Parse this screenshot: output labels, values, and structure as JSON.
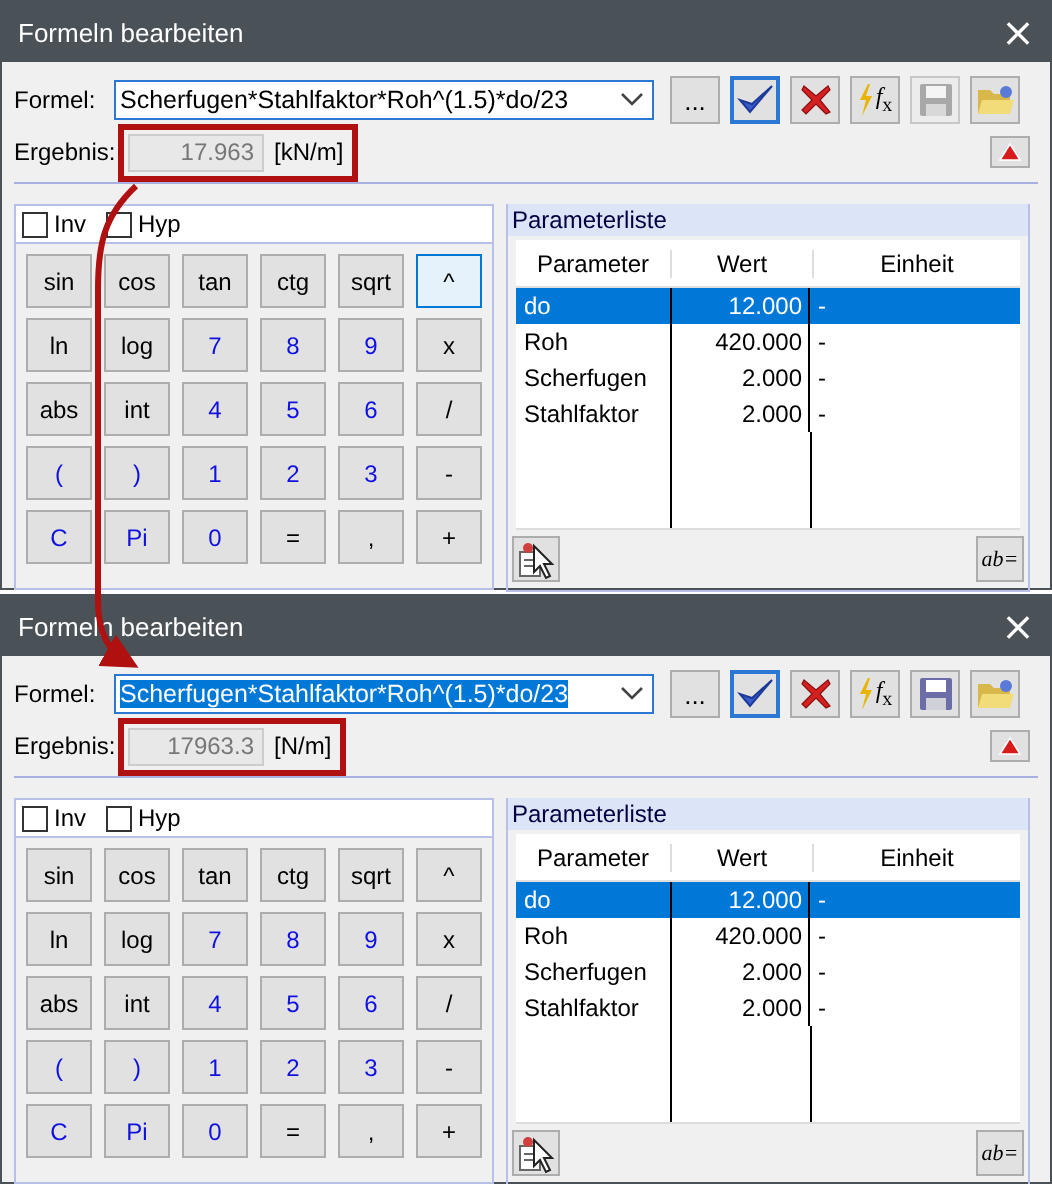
{
  "dialogs": [
    {
      "title": "Formeln bearbeiten",
      "close": "×",
      "formula_label": "Formel:",
      "formula": "Scherfugen*Stahlfaktor*Roh^(1.5)*do/23",
      "formula_selected": false,
      "result_label": "Ergebnis:",
      "result": "17.963",
      "unit": "[kN/m]",
      "highlighted": true,
      "ellipsis": "...",
      "fx_label": "*f*$_{x}$",
      "save_enabled": false,
      "checkboxes": [
        {
          "label": "Inv",
          "checked": false
        },
        {
          "label": "Hyp",
          "checked": false
        }
      ],
      "keys": [
        {
          "label": "sin",
          "kind": "func",
          "focused": false
        },
        {
          "label": "cos",
          "kind": "func",
          "focused": false
        },
        {
          "label": "tan",
          "kind": "func",
          "focused": false
        },
        {
          "label": "ctg",
          "kind": "func",
          "focused": false
        },
        {
          "label": "sqrt",
          "kind": "func",
          "focused": false
        },
        {
          "label": "^",
          "kind": "func",
          "focused": true
        },
        {
          "label": "ln",
          "kind": "func",
          "focused": false
        },
        {
          "label": "log",
          "kind": "func",
          "focused": false
        },
        {
          "label": "7",
          "kind": "digit",
          "focused": false
        },
        {
          "label": "8",
          "kind": "digit",
          "focused": false
        },
        {
          "label": "9",
          "kind": "digit",
          "focused": false
        },
        {
          "label": "x",
          "kind": "func",
          "focused": false
        },
        {
          "label": "abs",
          "kind": "func",
          "focused": false
        },
        {
          "label": "int",
          "kind": "func",
          "focused": false
        },
        {
          "label": "4",
          "kind": "digit",
          "focused": false
        },
        {
          "label": "5",
          "kind": "digit",
          "focused": false
        },
        {
          "label": "6",
          "kind": "digit",
          "focused": false
        },
        {
          "label": "/",
          "kind": "func",
          "focused": false
        },
        {
          "label": "(",
          "kind": "digit",
          "focused": false
        },
        {
          "label": ")",
          "kind": "digit",
          "focused": false
        },
        {
          "label": "1",
          "kind": "digit",
          "focused": false
        },
        {
          "label": "2",
          "kind": "digit",
          "focused": false
        },
        {
          "label": "3",
          "kind": "digit",
          "focused": false
        },
        {
          "label": "-",
          "kind": "func",
          "focused": false
        },
        {
          "label": "C",
          "kind": "digit",
          "focused": false
        },
        {
          "label": "Pi",
          "kind": "digit",
          "focused": false
        },
        {
          "label": "0",
          "kind": "digit",
          "focused": false
        },
        {
          "label": "=",
          "kind": "func",
          "focused": false
        },
        {
          "label": ",",
          "kind": "func",
          "focused": false
        },
        {
          "label": "+",
          "kind": "func",
          "focused": false
        }
      ],
      "parameter_list": {
        "title": "Parameterliste",
        "columns": [
          "Parameter",
          "Wert",
          "Einheit"
        ],
        "rows": [
          {
            "name": "do",
            "value": "12.000",
            "unit": "-",
            "selected": true
          },
          {
            "name": "Roh",
            "value": "420.000",
            "unit": "-",
            "selected": false
          },
          {
            "name": "Scherfugen",
            "value": "2.000",
            "unit": "-",
            "selected": false
          },
          {
            "name": "Stahlfaktor",
            "value": "2.000",
            "unit": "-",
            "selected": false
          }
        ]
      },
      "abc_label": "ab="
    },
    {
      "title": "Formeln bearbeiten",
      "close": "×",
      "formula_label": "Formel:",
      "formula": "Scherfugen*Stahlfaktor*Roh^(1.5)*do/23",
      "formula_selected": true,
      "result_label": "Ergebnis:",
      "result": "17963.3",
      "unit": "[N/m]",
      "highlighted": true,
      "ellipsis": "...",
      "fx_label": "*f*$_{x}$",
      "save_enabled": true,
      "checkboxes": [
        {
          "label": "Inv",
          "checked": false
        },
        {
          "label": "Hyp",
          "checked": false
        }
      ],
      "keys": [
        {
          "label": "sin",
          "kind": "func",
          "focused": false
        },
        {
          "label": "cos",
          "kind": "func",
          "focused": false
        },
        {
          "label": "tan",
          "kind": "func",
          "focused": false
        },
        {
          "label": "ctg",
          "kind": "func",
          "focused": false
        },
        {
          "label": "sqrt",
          "kind": "func",
          "focused": false
        },
        {
          "label": "^",
          "kind": "func",
          "focused": false
        },
        {
          "label": "ln",
          "kind": "func",
          "focused": false
        },
        {
          "label": "log",
          "kind": "func",
          "focused": false
        },
        {
          "label": "7",
          "kind": "digit",
          "focused": false
        },
        {
          "label": "8",
          "kind": "digit",
          "focused": false
        },
        {
          "label": "9",
          "kind": "digit",
          "focused": false
        },
        {
          "label": "x",
          "kind": "func",
          "focused": false
        },
        {
          "label": "abs",
          "kind": "func",
          "focused": false
        },
        {
          "label": "int",
          "kind": "func",
          "focused": false
        },
        {
          "label": "4",
          "kind": "digit",
          "focused": false
        },
        {
          "label": "5",
          "kind": "digit",
          "focused": false
        },
        {
          "label": "6",
          "kind": "digit",
          "focused": false
        },
        {
          "label": "/",
          "kind": "func",
          "focused": false
        },
        {
          "label": "(",
          "kind": "digit",
          "focused": false
        },
        {
          "label": ")",
          "kind": "digit",
          "focused": false
        },
        {
          "label": "1",
          "kind": "digit",
          "focused": false
        },
        {
          "label": "2",
          "kind": "digit",
          "focused": false
        },
        {
          "label": "3",
          "kind": "digit",
          "focused": false
        },
        {
          "label": "-",
          "kind": "func",
          "focused": false
        },
        {
          "label": "C",
          "kind": "digit",
          "focused": false
        },
        {
          "label": "Pi",
          "kind": "digit",
          "focused": false
        },
        {
          "label": "0",
          "kind": "digit",
          "focused": false
        },
        {
          "label": "=",
          "kind": "func",
          "focused": false
        },
        {
          "label": ",",
          "kind": "func",
          "focused": false
        },
        {
          "label": "+",
          "kind": "func",
          "focused": false
        }
      ],
      "parameter_list": {
        "title": "Parameterliste",
        "columns": [
          "Parameter",
          "Wert",
          "Einheit"
        ],
        "rows": [
          {
            "name": "do",
            "value": "12.000",
            "unit": "-",
            "selected": true
          },
          {
            "name": "Roh",
            "value": "420.000",
            "unit": "-",
            "selected": false
          },
          {
            "name": "Scherfugen",
            "value": "2.000",
            "unit": "-",
            "selected": false
          },
          {
            "name": "Stahlfaktor",
            "value": "2.000",
            "unit": "-",
            "selected": false
          }
        ]
      },
      "abc_label": "ab="
    }
  ]
}
